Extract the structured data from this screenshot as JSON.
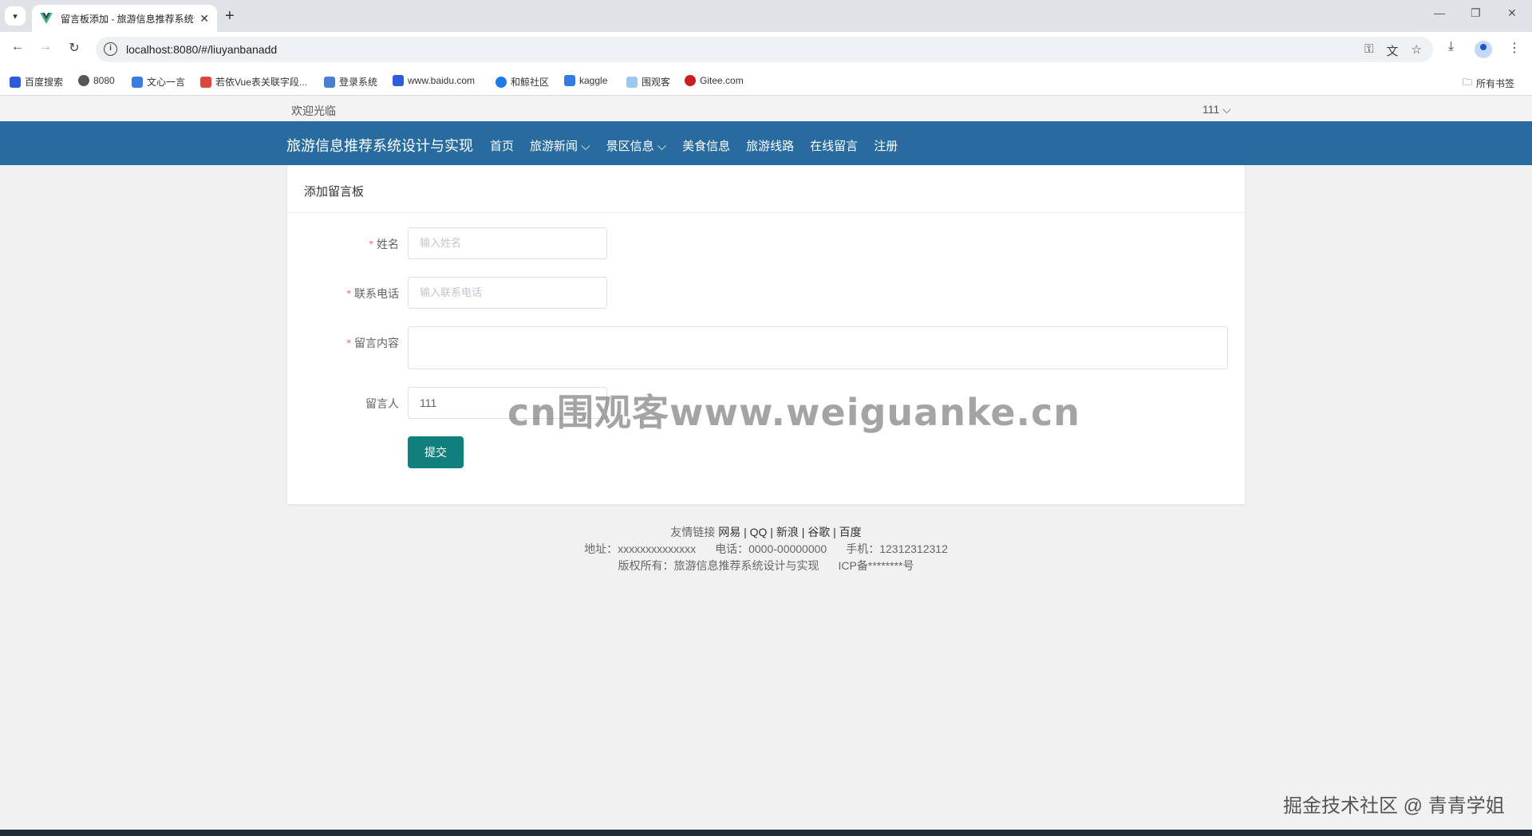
{
  "browser": {
    "tab_title": "留言板添加 - 旅游信息推荐系统设计与实现",
    "new_tab": "+",
    "url": "localhost:8080/#/liuyanbanadd",
    "bookmarks": [
      {
        "label": "百度搜索",
        "color": "#2e5bd8"
      },
      {
        "label": "8080",
        "color": "#555555"
      },
      {
        "label": "文心一言",
        "color": "#3a7be0"
      },
      {
        "label": "若依Vue表关联字段...",
        "color": "#d9483b"
      },
      {
        "label": "登录系统",
        "color": "#4a7fd0"
      },
      {
        "label": "www.baidu.com",
        "color": "#2e5bd8"
      },
      {
        "label": "和鲸社区",
        "color": "#1e7ae6"
      },
      {
        "label": "kaggle",
        "color": "#2f7de1"
      },
      {
        "label": "围观客",
        "color": "#9cc8ee"
      },
      {
        "label": "Gitee.com",
        "color": "#c71d23"
      }
    ],
    "all_bookmarks": "所有书签"
  },
  "header": {
    "welcome": "欢迎光临",
    "user": "111",
    "brand": "旅游信息推荐系统设计与实现",
    "menu": [
      "首页",
      "旅游新闻",
      "景区信息",
      "美食信息",
      "旅游线路",
      "在线留言",
      "注册"
    ]
  },
  "form": {
    "title": "添加留言板",
    "name_label": "姓名",
    "name_placeholder": "输入姓名",
    "phone_label": "联系电话",
    "phone_placeholder": "输入联系电话",
    "content_label": "留言内容",
    "author_label": "留言人",
    "author_value": "111",
    "submit": "提交"
  },
  "watermark": "cn围观客www.weiguanke.cn",
  "footer": {
    "links_label": "友情链接",
    "links": "网易 | QQ | 新浪 | 谷歌 | 百度",
    "address": "地址：xxxxxxxxxxxxxx",
    "phone": "电话：0000-00000000",
    "mobile": "手机：12312312312",
    "copyright": "版权所有：旅游信息推荐系统设计与实现",
    "icp": "ICP备********号"
  },
  "juejin_mark": "掘金技术社区 @ 青青学姐",
  "accent": "#286c9f",
  "button_color": "#11807d"
}
